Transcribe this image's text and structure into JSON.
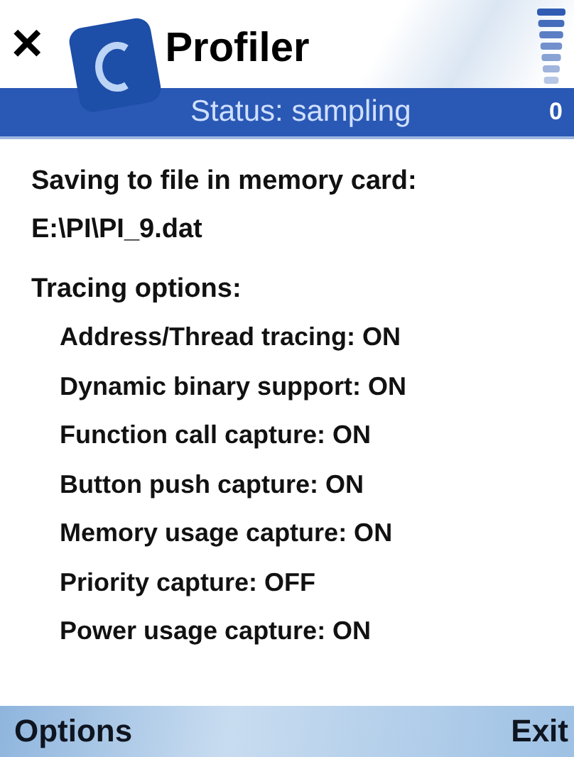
{
  "title_bar": {
    "close": "×",
    "app_title": "Profiler",
    "status": "Status: sampling",
    "indicator": "0"
  },
  "content": {
    "saving_label": "Saving to file in memory card:",
    "file_path": "E:\\PI\\PI_9.dat",
    "section_title": "Tracing options:",
    "options": [
      {
        "label": "Address/Thread tracing: ON"
      },
      {
        "label": "Dynamic binary support: ON"
      },
      {
        "label": "Function call capture: ON"
      },
      {
        "label": "Button push capture: ON"
      },
      {
        "label": "Memory usage capture: ON"
      },
      {
        "label": "Priority capture: OFF"
      },
      {
        "label": "Power usage capture: ON"
      }
    ]
  },
  "softkeys": {
    "left": "Options",
    "right": "Exit"
  }
}
